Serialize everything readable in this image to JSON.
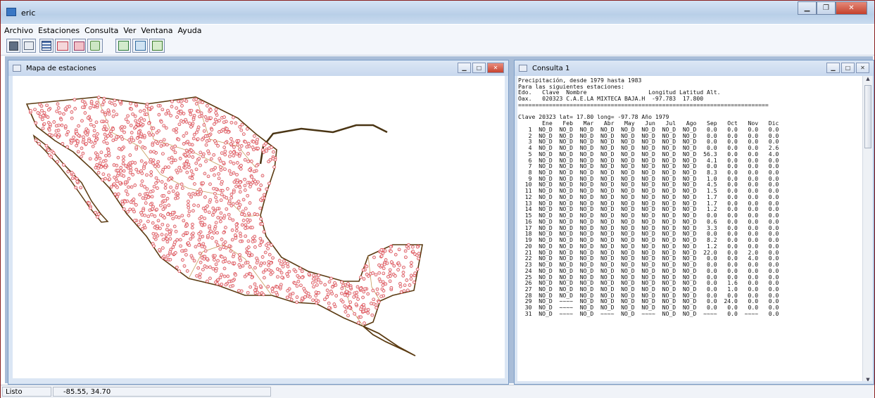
{
  "app": {
    "title": "eric"
  },
  "menu": [
    "Archivo",
    "Estaciones",
    "Consulta",
    "Ver",
    "Ventana",
    "Ayuda"
  ],
  "toolbar": {
    "buttons": [
      "save-icon",
      "print-icon",
      "station-table-icon",
      "map-query-icon",
      "grid-map-icon",
      "layers-icon",
      "export-table-icon",
      "export-map-icon",
      "export-chart-icon"
    ]
  },
  "map_window": {
    "title": "Mapa de estaciones",
    "marker_color": "#d9363e",
    "coast_color": "#5b3b12",
    "border_color": "#c69c5d"
  },
  "query_window": {
    "title": "Consulta 1",
    "header_lines": [
      "Precipitación, desde 1979 hasta 1983",
      "Para las siguientes estaciones:",
      "Edo.   Clave  Nombre                  Longitud Latitud Alt.",
      "Oax.   020323 C.A.E.LA MIXTECA BAJA.H  -97.783  17.800",
      "=========================================================================",
      "",
      "Clave 20323 lat= 17.80 long= -97.78 Año 1979"
    ],
    "columns": [
      "Ene",
      "Feb",
      "Mar",
      "Abr",
      "May",
      "Jun",
      "Jul",
      "Ago",
      "Sep",
      "Oct",
      "Nov",
      "Dic"
    ],
    "rows": [
      [
        "1",
        "NO_D",
        "NO_D",
        "NO_D",
        "NO_D",
        "NO_D",
        "NO_D",
        "NO_D",
        "NO_D",
        "0.0",
        "0.0",
        "0.0",
        "0.0"
      ],
      [
        "2",
        "NO_D",
        "NO_D",
        "NO_D",
        "NO_D",
        "NO_D",
        "NO_D",
        "NO_D",
        "NO_D",
        "0.0",
        "0.0",
        "0.0",
        "0.0"
      ],
      [
        "3",
        "NO_D",
        "NO_D",
        "NO_D",
        "NO_D",
        "NO_D",
        "NO_D",
        "NO_D",
        "NO_D",
        "0.0",
        "0.0",
        "0.0",
        "0.0"
      ],
      [
        "4",
        "NO_D",
        "NO_D",
        "NO_D",
        "NO_D",
        "NO_D",
        "NO_D",
        "NO_D",
        "NO_D",
        "0.0",
        "0.0",
        "0.0",
        "2.6"
      ],
      [
        "5",
        "NO_D",
        "NO_D",
        "NO_D",
        "NO_D",
        "NO_D",
        "NO_D",
        "NO_D",
        "NO_D",
        "56.3",
        "0.0",
        "0.0",
        "4.0"
      ],
      [
        "6",
        "NO_D",
        "NO_D",
        "NO_D",
        "NO_D",
        "NO_D",
        "NO_D",
        "NO_D",
        "NO_D",
        "4.1",
        "0.0",
        "0.0",
        "0.0"
      ],
      [
        "7",
        "NO_D",
        "NO_D",
        "NO_D",
        "NO_D",
        "NO_D",
        "NO_D",
        "NO_D",
        "NO_D",
        "0.0",
        "0.0",
        "0.0",
        "0.0"
      ],
      [
        "8",
        "NO_D",
        "NO_D",
        "NO_D",
        "NO_D",
        "NO_D",
        "NO_D",
        "NO_D",
        "NO_D",
        "8.3",
        "0.0",
        "0.0",
        "0.0"
      ],
      [
        "9",
        "NO_D",
        "NO_D",
        "NO_D",
        "NO_D",
        "NO_D",
        "NO_D",
        "NO_D",
        "NO_D",
        "1.0",
        "0.0",
        "0.0",
        "0.0"
      ],
      [
        "10",
        "NO_D",
        "NO_D",
        "NO_D",
        "NO_D",
        "NO_D",
        "NO_D",
        "NO_D",
        "NO_D",
        "4.5",
        "0.0",
        "0.0",
        "0.0"
      ],
      [
        "11",
        "NO_D",
        "NO_D",
        "NO_D",
        "NO_D",
        "NO_D",
        "NO_D",
        "NO_D",
        "NO_D",
        "1.5",
        "0.0",
        "0.0",
        "0.0"
      ],
      [
        "12",
        "NO_D",
        "NO_D",
        "NO_D",
        "NO_D",
        "NO_D",
        "NO_D",
        "NO_D",
        "NO_D",
        "1.7",
        "0.0",
        "0.0",
        "0.0"
      ],
      [
        "13",
        "NO_D",
        "NO_D",
        "NO_D",
        "NO_D",
        "NO_D",
        "NO_D",
        "NO_D",
        "NO_D",
        "1.7",
        "0.0",
        "0.0",
        "0.0"
      ],
      [
        "14",
        "NO_D",
        "NO_D",
        "NO_D",
        "NO_D",
        "NO_D",
        "NO_D",
        "NO_D",
        "NO_D",
        "1.2",
        "0.0",
        "0.0",
        "0.0"
      ],
      [
        "15",
        "NO_D",
        "NO_D",
        "NO_D",
        "NO_D",
        "NO_D",
        "NO_D",
        "NO_D",
        "NO_D",
        "0.0",
        "0.0",
        "0.0",
        "0.0"
      ],
      [
        "16",
        "NO_D",
        "NO_D",
        "NO_D",
        "NO_D",
        "NO_D",
        "NO_D",
        "NO_D",
        "NO_D",
        "0.6",
        "0.0",
        "0.0",
        "0.0"
      ],
      [
        "17",
        "NO_D",
        "NO_D",
        "NO_D",
        "NO_D",
        "NO_D",
        "NO_D",
        "NO_D",
        "NO_D",
        "3.3",
        "0.0",
        "0.0",
        "0.0"
      ],
      [
        "18",
        "NO_D",
        "NO_D",
        "NO_D",
        "NO_D",
        "NO_D",
        "NO_D",
        "NO_D",
        "NO_D",
        "0.0",
        "0.0",
        "0.0",
        "0.0"
      ],
      [
        "19",
        "NO_D",
        "NO_D",
        "NO_D",
        "NO_D",
        "NO_D",
        "NO_D",
        "NO_D",
        "NO_D",
        "8.2",
        "0.0",
        "0.0",
        "0.0"
      ],
      [
        "20",
        "NO_D",
        "NO_D",
        "NO_D",
        "NO_D",
        "NO_D",
        "NO_D",
        "NO_D",
        "NO_D",
        "1.2",
        "0.0",
        "0.0",
        "0.0"
      ],
      [
        "21",
        "NO_D",
        "NO_D",
        "NO_D",
        "NO_D",
        "NO_D",
        "NO_D",
        "NO_D",
        "NO_D",
        "22.0",
        "0.0",
        "2.0",
        "0.0"
      ],
      [
        "22",
        "NO_D",
        "NO_D",
        "NO_D",
        "NO_D",
        "NO_D",
        "NO_D",
        "NO_D",
        "NO_D",
        "0.0",
        "0.0",
        "4.0",
        "0.0"
      ],
      [
        "23",
        "NO_D",
        "NO_D",
        "NO_D",
        "NO_D",
        "NO_D",
        "NO_D",
        "NO_D",
        "NO_D",
        "0.0",
        "0.0",
        "0.0",
        "0.0"
      ],
      [
        "24",
        "NO_D",
        "NO_D",
        "NO_D",
        "NO_D",
        "NO_D",
        "NO_D",
        "NO_D",
        "NO_D",
        "0.0",
        "0.0",
        "0.0",
        "0.0"
      ],
      [
        "25",
        "NO_D",
        "NO_D",
        "NO_D",
        "NO_D",
        "NO_D",
        "NO_D",
        "NO_D",
        "NO_D",
        "0.0",
        "0.0",
        "0.0",
        "0.0"
      ],
      [
        "26",
        "NO_D",
        "NO_D",
        "NO_D",
        "NO_D",
        "NO_D",
        "NO_D",
        "NO_D",
        "NO_D",
        "0.0",
        "1.6",
        "0.0",
        "0.0"
      ],
      [
        "27",
        "NO_D",
        "NO_D",
        "NO_D",
        "NO_D",
        "NO_D",
        "NO_D",
        "NO_D",
        "NO_D",
        "0.0",
        "1.0",
        "0.0",
        "0.0"
      ],
      [
        "28",
        "NO_D",
        "NO_D",
        "NO_D",
        "NO_D",
        "NO_D",
        "NO_D",
        "NO_D",
        "NO_D",
        "0.0",
        "0.0",
        "0.0",
        "0.0"
      ],
      [
        "29",
        "NO_D",
        "~~~~",
        "NO_D",
        "NO_D",
        "NO_D",
        "NO_D",
        "NO_D",
        "NO_D",
        "0.0",
        "24.0",
        "0.0",
        "0.0"
      ],
      [
        "30",
        "NO_D",
        "~~~~",
        "NO_D",
        "NO_D",
        "NO_D",
        "NO_D",
        "NO_D",
        "NO_D",
        "0.0",
        "0.0",
        "0.0",
        "0.0"
      ],
      [
        "31",
        "NO_D",
        "~~~~",
        "NO_D",
        "~~~~",
        "NO_D",
        "~~~~",
        "NO_D",
        "NO_D",
        "~~~~",
        "0.0",
        "~~~~",
        "0.0"
      ]
    ]
  },
  "status": {
    "text": "Listo",
    "coords": "-85.55, 34.70"
  }
}
